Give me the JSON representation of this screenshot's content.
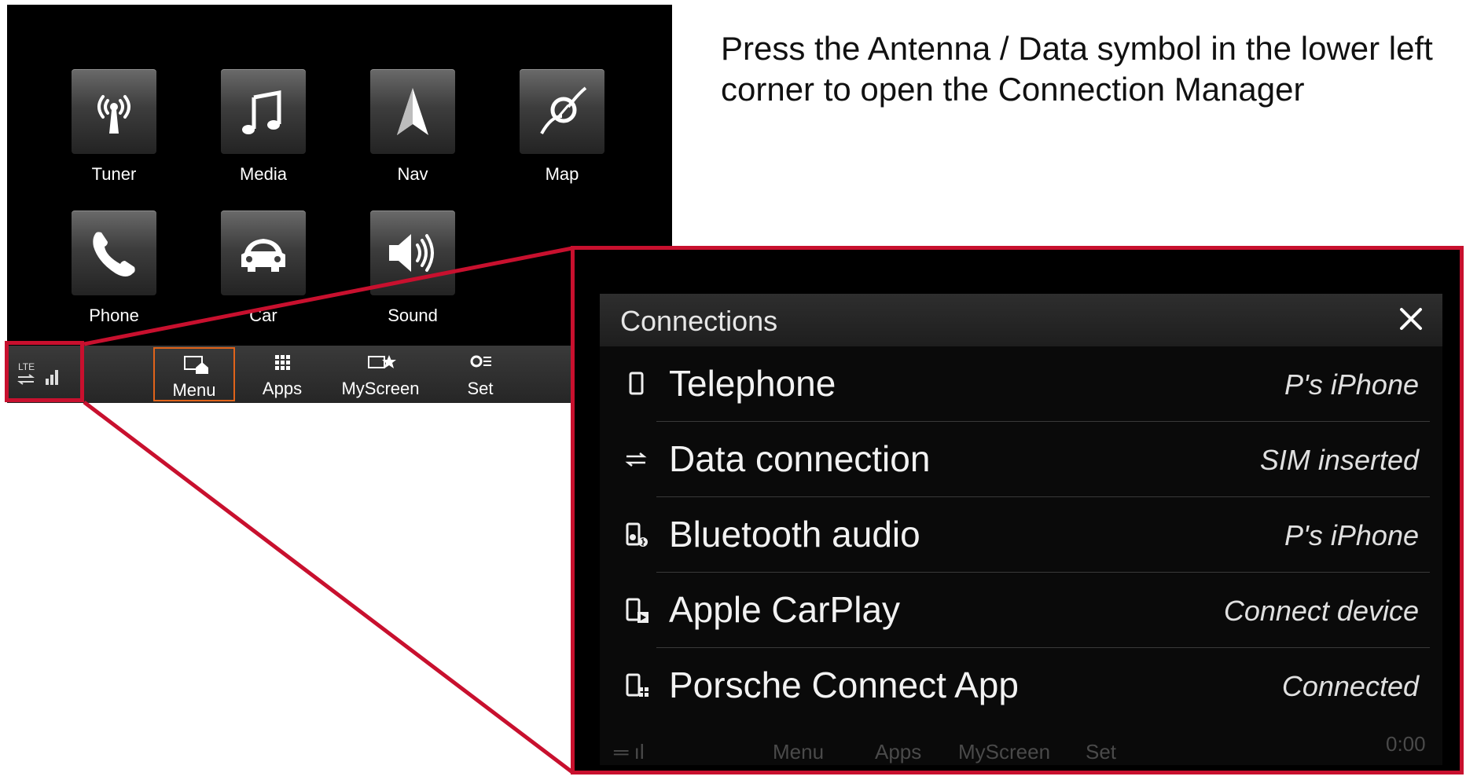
{
  "instruction": "Press the Antenna / Data symbol in the lower left corner to open the Connection Manager",
  "home_screen": {
    "tiles": [
      {
        "label": "Tuner"
      },
      {
        "label": "Media"
      },
      {
        "label": "Nav"
      },
      {
        "label": "Map"
      },
      {
        "label": "Phone"
      },
      {
        "label": "Car"
      },
      {
        "label": "Sound"
      }
    ],
    "status": {
      "network": "LTE"
    },
    "bottom_bar": [
      {
        "label": "Menu",
        "active": true
      },
      {
        "label": "Apps"
      },
      {
        "label": "MyScreen"
      },
      {
        "label": "Set"
      }
    ]
  },
  "connections_panel": {
    "title": "Connections",
    "items": [
      {
        "label": "Telephone",
        "value": "P's iPhone",
        "icon": "phone-icon"
      },
      {
        "label": "Data connection",
        "value": "SIM inserted",
        "icon": "data-icon"
      },
      {
        "label": "Bluetooth audio",
        "value": "P's iPhone",
        "icon": "bluetooth-audio-icon"
      },
      {
        "label": "Apple CarPlay",
        "value": "Connect device",
        "icon": "carplay-icon"
      },
      {
        "label": "Porsche Connect App",
        "value": "Connected",
        "icon": "connect-app-icon"
      }
    ],
    "ghost_bar": {
      "menu": "Menu",
      "apps": "Apps",
      "myscreen": "MyScreen",
      "set": "Set",
      "clock": "0:00"
    }
  },
  "colors": {
    "highlight": "#c8102e",
    "active_tab": "#e0631a",
    "screen_bg": "#000000"
  }
}
